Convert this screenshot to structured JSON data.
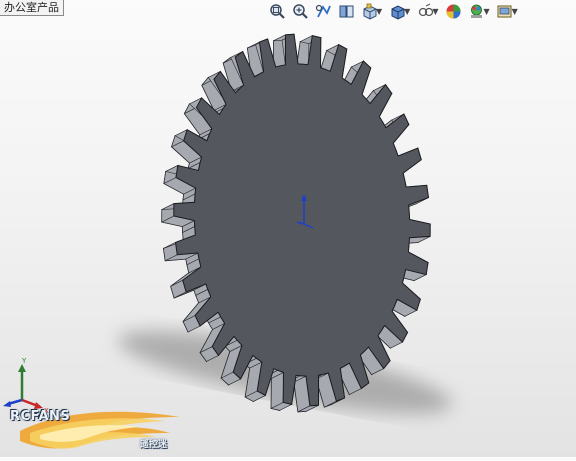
{
  "window": {
    "tab_label": "办公室产品"
  },
  "toolbar": {
    "buttons": [
      {
        "icon": "zoom-to-fit-icon",
        "has_dropdown": false
      },
      {
        "icon": "zoom-area-icon",
        "has_dropdown": false
      },
      {
        "icon": "previous-view-icon",
        "has_dropdown": false
      },
      {
        "icon": "section-view-icon",
        "has_dropdown": false
      },
      {
        "icon": "view-orientation-icon",
        "has_dropdown": true
      },
      {
        "icon": "display-style-icon",
        "has_dropdown": true
      },
      {
        "icon": "hide-show-items-icon",
        "has_dropdown": true
      },
      {
        "icon": "edit-appearance-icon",
        "has_dropdown": false
      },
      {
        "icon": "apply-scene-icon",
        "has_dropdown": true
      },
      {
        "icon": "view-settings-icon",
        "has_dropdown": true
      }
    ]
  },
  "model": {
    "type": "spur-gear",
    "tooth_count": 30,
    "body_color": "#54575e",
    "edge_color": "#1b1c20"
  },
  "triad": {
    "x_label": "X",
    "y_label": "Y",
    "x_color": "#c62828",
    "y_color": "#2e7d32",
    "z_color": "#1e40c8"
  },
  "watermark": {
    "brand": "RCFANS",
    "sub": "遥控迷"
  },
  "colors": {
    "background_top": "#fbfbfb",
    "background_bottom": "#e3e3e3"
  }
}
